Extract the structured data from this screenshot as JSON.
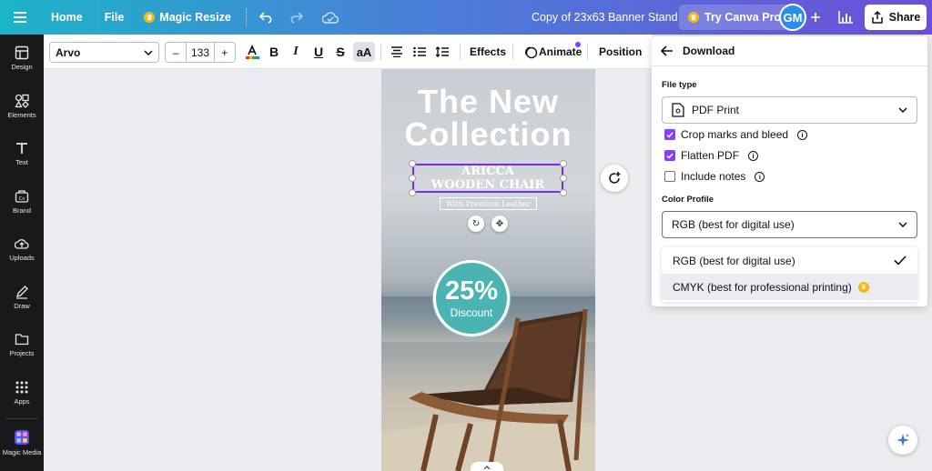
{
  "topbar": {
    "home": "Home",
    "file": "File",
    "magic_resize": "Magic Resize",
    "doc_title": "Copy of 23x63  Banner Stand",
    "try_pro": "Try Canva Pro",
    "avatar": "GM",
    "share": "Share"
  },
  "rail": {
    "items": [
      {
        "label": "Design",
        "icon": "design-icon"
      },
      {
        "label": "Elements",
        "icon": "elements-icon"
      },
      {
        "label": "Text",
        "icon": "text-icon"
      },
      {
        "label": "Brand",
        "icon": "brand-icon"
      },
      {
        "label": "Uploads",
        "icon": "uploads-icon"
      },
      {
        "label": "Draw",
        "icon": "draw-icon"
      },
      {
        "label": "Projects",
        "icon": "projects-icon"
      },
      {
        "label": "Apps",
        "icon": "apps-icon"
      }
    ],
    "magic_media": "Magic Media"
  },
  "toolbar": {
    "font": "Arvo",
    "size": "133",
    "effects": "Effects",
    "animate": "Animate",
    "position": "Position"
  },
  "canvas": {
    "title_line1": "The New",
    "title_line2": "Collection",
    "sub_line1": "ARICCA",
    "sub_line2": "WOODEN CHAIR",
    "leather": "With Premium Leather",
    "discount_pct": "25%",
    "discount_label": "Discount"
  },
  "download": {
    "title": "Download",
    "file_type_label": "File type",
    "file_type_value": "PDF Print",
    "options": [
      {
        "label": "Crop marks and bleed",
        "checked": true
      },
      {
        "label": "Flatten PDF",
        "checked": true
      },
      {
        "label": "Include notes",
        "checked": false
      }
    ],
    "color_profile_label": "Color Profile",
    "color_profile_value": "RGB (best for digital use)",
    "dropdown": [
      {
        "label": "RGB (best for digital use)",
        "selected": true
      },
      {
        "label": "CMYK (best for professional printing)",
        "pro": true
      }
    ]
  },
  "colors": {
    "accent": "#8b3dff",
    "teal_badge": "#4ab4b3",
    "rail_bg": "#18191b"
  }
}
